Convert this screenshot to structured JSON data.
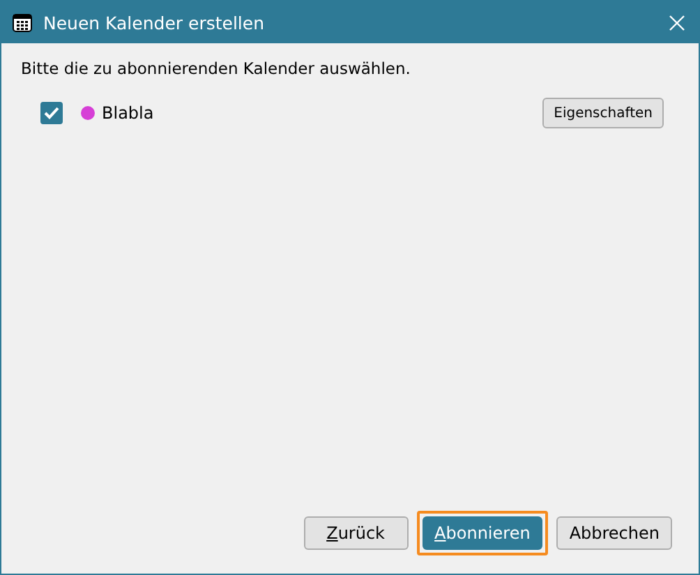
{
  "window": {
    "title": "Neuen Kalender erstellen"
  },
  "instruction": "Bitte die zu abonnierenden Kalender auswählen.",
  "calendars": [
    {
      "name": "Blabla",
      "checked": true,
      "color": "#d63fd6"
    }
  ],
  "properties_button": "Eigenschaften",
  "buttons": [
    {
      "label": "Zurück",
      "mnemonic": true,
      "primary": false,
      "focused": false
    },
    {
      "label": "Abonnieren",
      "mnemonic": true,
      "primary": true,
      "focused": true
    },
    {
      "label": "Abbrechen",
      "mnemonic": false,
      "primary": false,
      "focused": false
    }
  ]
}
